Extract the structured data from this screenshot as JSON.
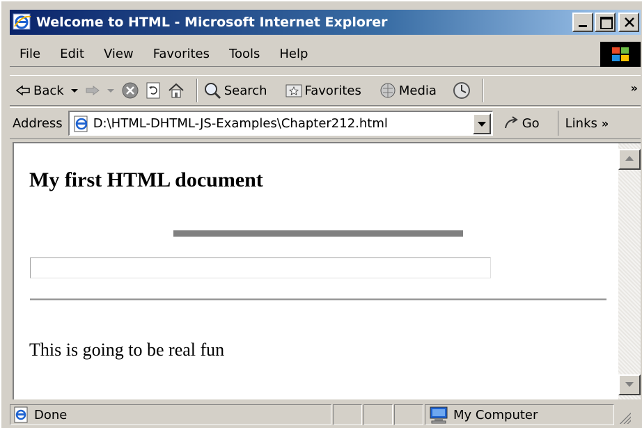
{
  "window": {
    "title": "Welcome to HTML - Microsoft Internet Explorer"
  },
  "menu": {
    "items": [
      "File",
      "Edit",
      "View",
      "Favorites",
      "Tools",
      "Help"
    ]
  },
  "toolbar": {
    "back_label": "Back",
    "search_label": "Search",
    "favorites_label": "Favorites",
    "media_label": "Media"
  },
  "address": {
    "label": "Address",
    "url": "D:\\HTML-DHTML-JS-Examples\\Chapter212.html",
    "go_label": "Go",
    "links_label": "Links"
  },
  "page": {
    "heading": "My first HTML document",
    "paragraph": "This is going to be real fun"
  },
  "status": {
    "text": "Done",
    "zone": "My Computer"
  },
  "colors": {
    "title_gradient_start": "#0a246a",
    "title_gradient_end": "#a6caf0",
    "chrome": "#d4d0c8"
  }
}
